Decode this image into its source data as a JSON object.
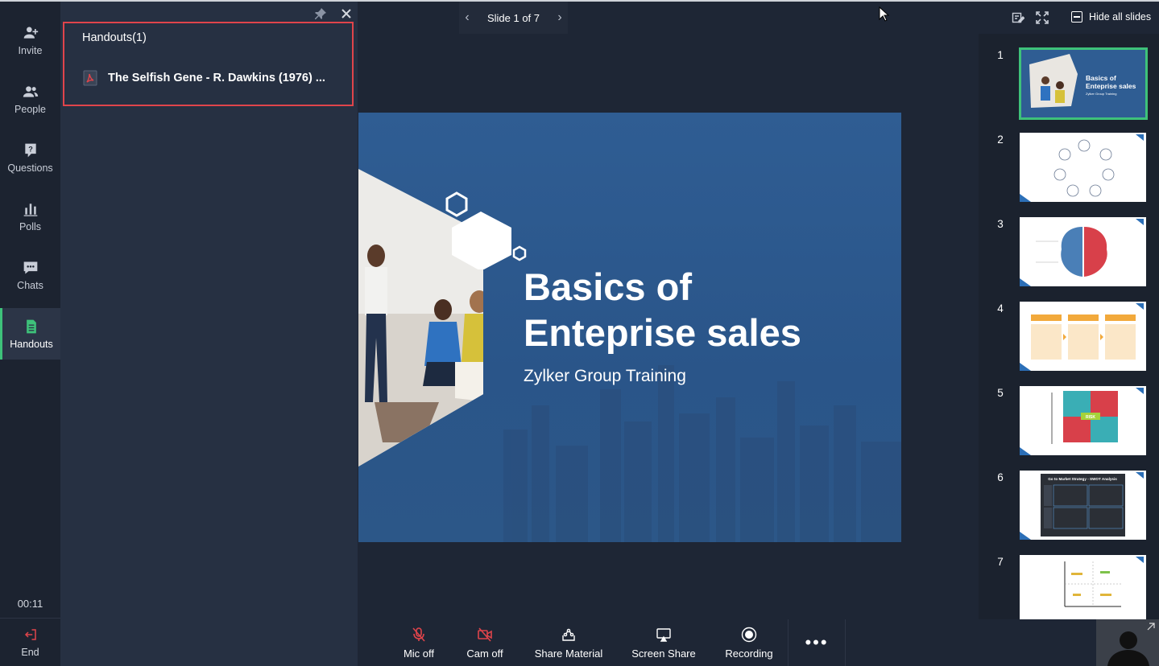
{
  "rail": {
    "items": [
      {
        "label": "Invite",
        "icon": "add-user-icon"
      },
      {
        "label": "People",
        "icon": "people-icon"
      },
      {
        "label": "Questions",
        "icon": "question-icon"
      },
      {
        "label": "Polls",
        "icon": "poll-icon"
      },
      {
        "label": "Chats",
        "icon": "chat-icon"
      },
      {
        "label": "Handouts",
        "icon": "handout-icon",
        "active": true
      }
    ],
    "timer": "00:11",
    "end_label": "End"
  },
  "handouts": {
    "title": "Handouts(1)",
    "files": [
      {
        "name": "The Selfish Gene - R. Dawkins (1976) ...",
        "icon": "pdf-icon"
      }
    ]
  },
  "topbar": {
    "slide_label": "Slide 1 of 7",
    "hide_all_label": "Hide all slides"
  },
  "slide": {
    "title_line1": "Basics of",
    "title_line2": "Enteprise sales",
    "subtitle": "Zylker Group Training"
  },
  "thumbnails": {
    "numbers": [
      "1",
      "2",
      "3",
      "4",
      "5",
      "6",
      "7"
    ],
    "slide1_title": "Basics of Enteprise sales",
    "slide1_sub": "Zylker Group Training",
    "slide5_cells": [
      "MODERATE TO HIGH RISK",
      "HIGHEST RISK",
      "RISK",
      "LOW RISK",
      "MODERATE TO HIGH RISK"
    ],
    "slide6_title": "Go to Market Strategy - SWOT Analysis"
  },
  "controls": {
    "mic": "Mic off",
    "cam": "Cam off",
    "share": "Share Material",
    "screen": "Screen Share",
    "recording": "Recording",
    "more": "•••"
  },
  "colors": {
    "accent": "#3ec27a",
    "alert": "#e0444b",
    "slide_bg": "#2f5d93"
  }
}
